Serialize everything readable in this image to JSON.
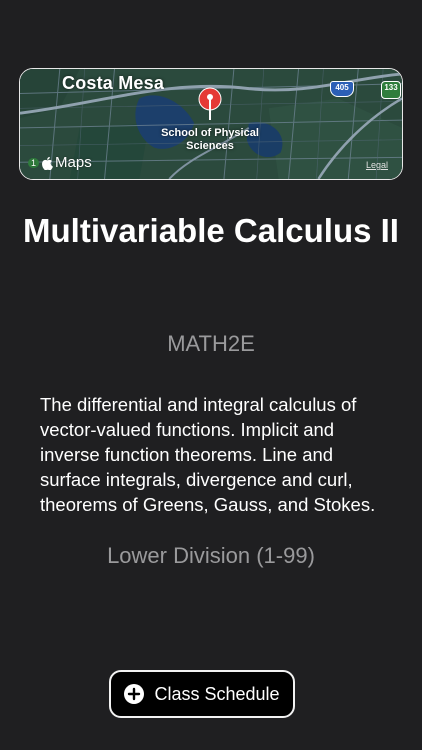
{
  "map": {
    "city_label": "Costa Mesa",
    "poi_label": "School of Physical Sciences",
    "highway_1": "405",
    "highway_2": "133",
    "zoom_marker": "1",
    "brand": "Maps",
    "legal": "Legal",
    "colors": {
      "land": "#2a4a3c",
      "water": "#1c3f6b",
      "road": "#6b7f8f",
      "pin": "#e53935"
    }
  },
  "course": {
    "title": "Multivariable Calculus II",
    "code": "MATH2E",
    "description": "The differential and integral calculus of vector-valued functions. Implicit and inverse function theorems. Line and surface integrals, divergence and curl, theorems of Greens, Gauss, and Stokes.",
    "division": "Lower Division (1-99)"
  },
  "actions": {
    "schedule_label": "Class Schedule",
    "schedule_icon": "plus-circle-icon"
  }
}
